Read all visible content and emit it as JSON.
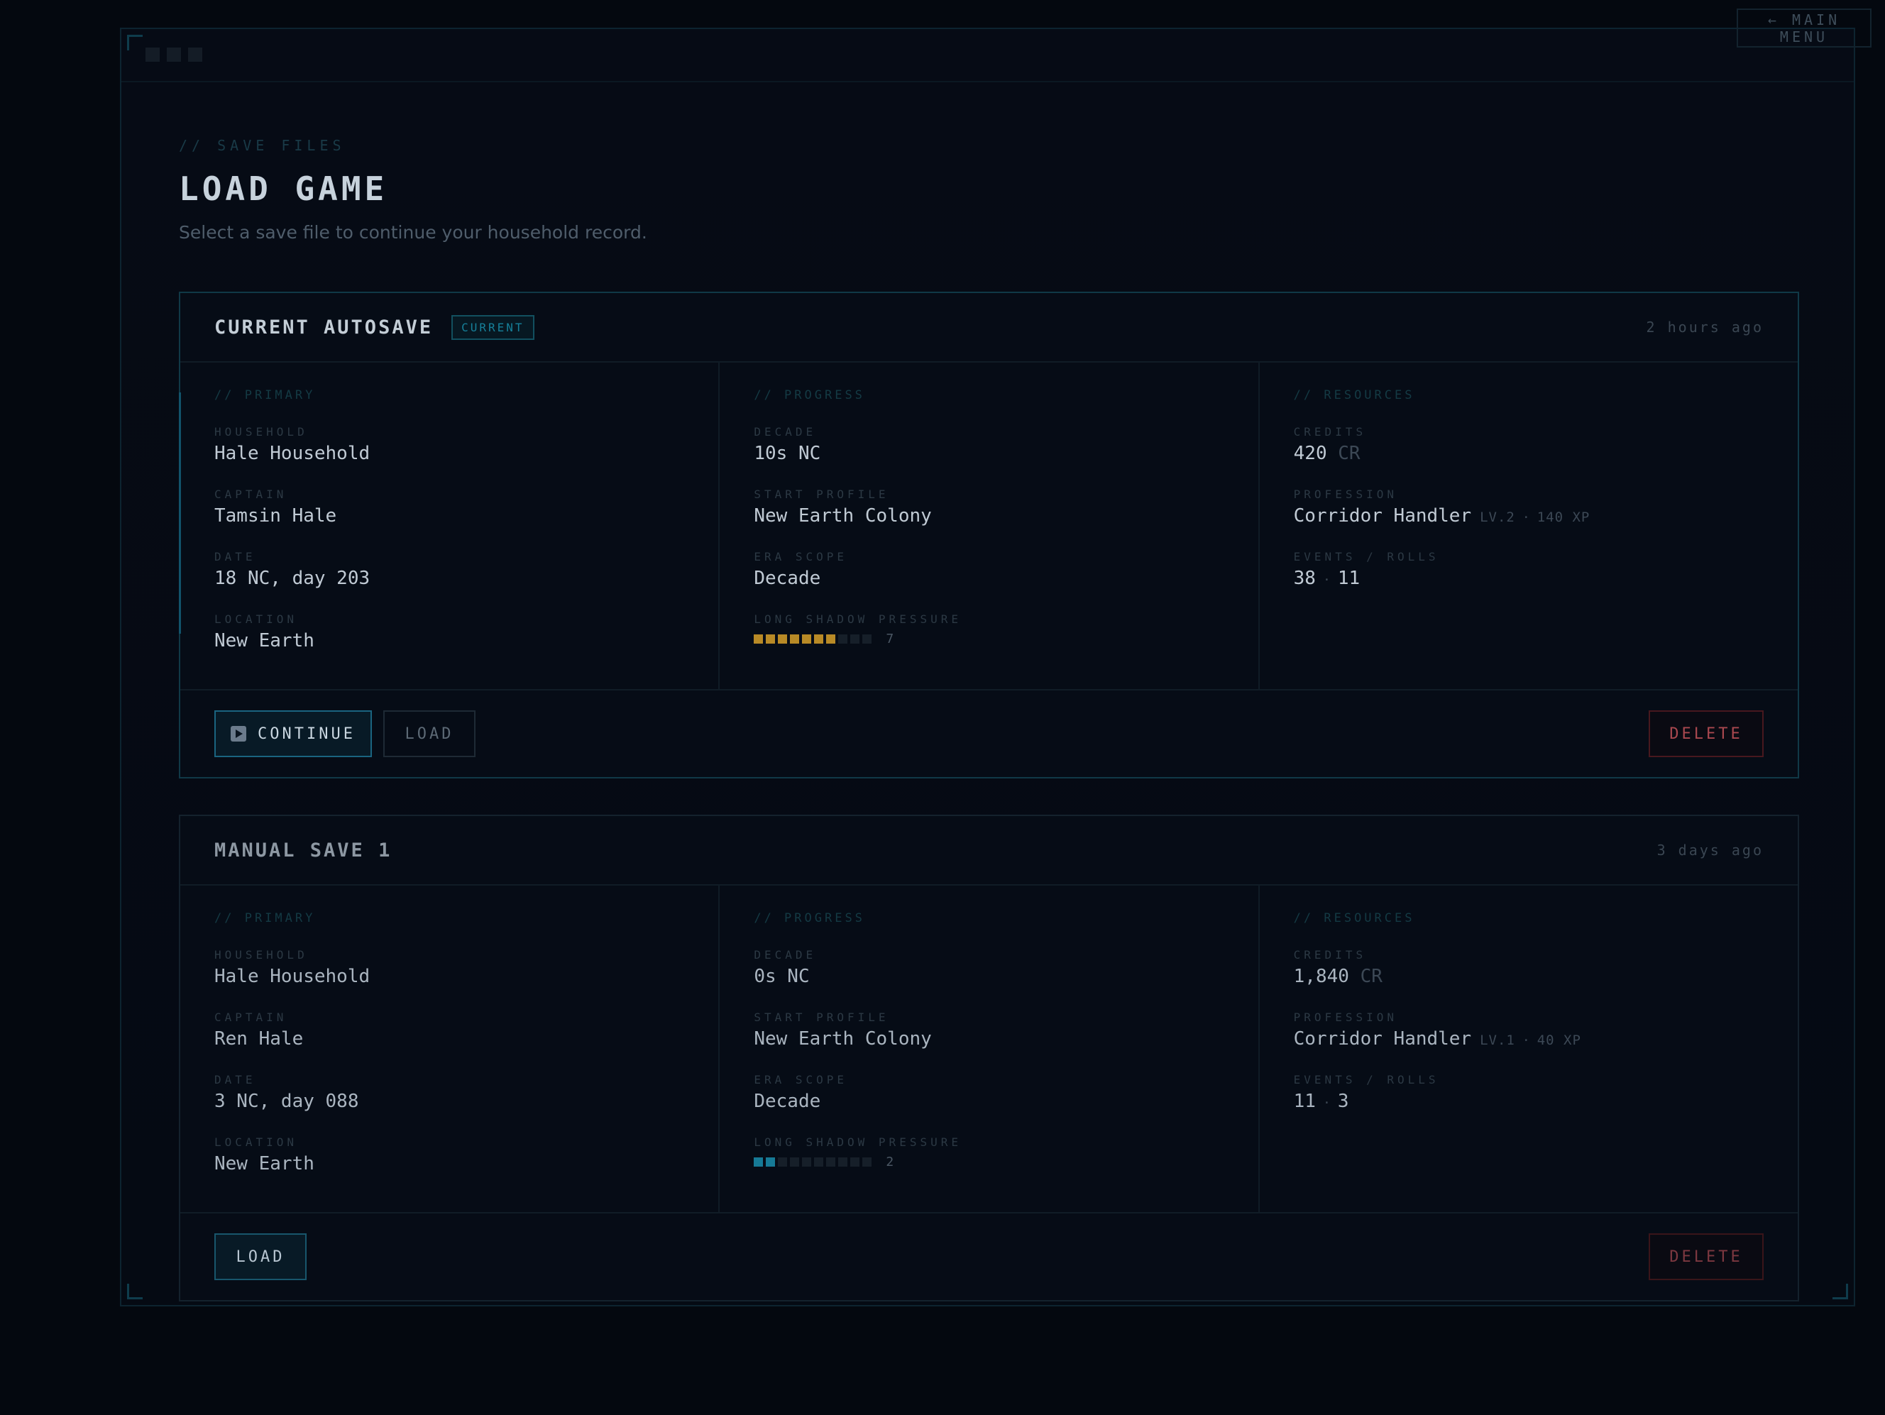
{
  "nav": {
    "main_menu_label": "← MAIN MENU"
  },
  "header": {
    "eyebrow": "// SAVE FILES",
    "title": "LOAD GAME",
    "subtitle": "Select a save file to continue your household record."
  },
  "saves": [
    {
      "title": "CURRENT AUTOSAVE",
      "badge": "CURRENT",
      "time_ago": "2 hours ago",
      "primary": {
        "section_label": "// PRIMARY",
        "household_label": "HOUSEHOLD",
        "household": "Hale Household",
        "captain_label": "CAPTAIN",
        "captain": "Tamsin Hale",
        "date_label": "DATE",
        "date": "18 NC, day 203",
        "location_label": "LOCATION",
        "location": "New Earth"
      },
      "progress": {
        "section_label": "// PROGRESS",
        "decade_label": "DECADE",
        "decade": "10s NC",
        "start_profile_label": "START PROFILE",
        "start_profile": "New Earth Colony",
        "era_scope_label": "ERA SCOPE",
        "era_scope": "Decade",
        "pressure_label": "LONG SHADOW PRESSURE",
        "pressure": "7",
        "pressure_max": 10,
        "pressure_color": "#b88a26"
      },
      "resources": {
        "section_label": "// RESOURCES",
        "credits_label": "CREDITS",
        "credits": "420",
        "credits_unit": "CR",
        "profession_label": "PROFESSION",
        "profession": "Corridor Handler",
        "profession_level": "LV.2",
        "profession_xp": "140 XP",
        "events_label": "EVENTS / ROLLS",
        "events": "38",
        "rolls": "11"
      },
      "actions": {
        "continue_label": "CONTINUE",
        "load_label": "LOAD",
        "delete_label": "DELETE"
      }
    },
    {
      "title": "MANUAL SAVE 1",
      "time_ago": "3 days ago",
      "primary": {
        "section_label": "// PRIMARY",
        "household_label": "HOUSEHOLD",
        "household": "Hale Household",
        "captain_label": "CAPTAIN",
        "captain": "Ren Hale",
        "date_label": "DATE",
        "date": "3 NC, day 088",
        "location_label": "LOCATION",
        "location": "New Earth"
      },
      "progress": {
        "section_label": "// PROGRESS",
        "decade_label": "DECADE",
        "decade": "0s NC",
        "start_profile_label": "START PROFILE",
        "start_profile": "New Earth Colony",
        "era_scope_label": "ERA SCOPE",
        "era_scope": "Decade",
        "pressure_label": "LONG SHADOW PRESSURE",
        "pressure": "2",
        "pressure_max": 10,
        "pressure_color": "#167a96"
      },
      "resources": {
        "section_label": "// RESOURCES",
        "credits_label": "CREDITS",
        "credits": "1,840",
        "credits_unit": "CR",
        "profession_label": "PROFESSION",
        "profession": "Corridor Handler",
        "profession_level": "LV.1",
        "profession_xp": "40 XP",
        "events_label": "EVENTS / ROLLS",
        "events": "11",
        "rolls": "3"
      },
      "actions": {
        "load_label": "LOAD",
        "delete_label": "DELETE"
      }
    }
  ]
}
